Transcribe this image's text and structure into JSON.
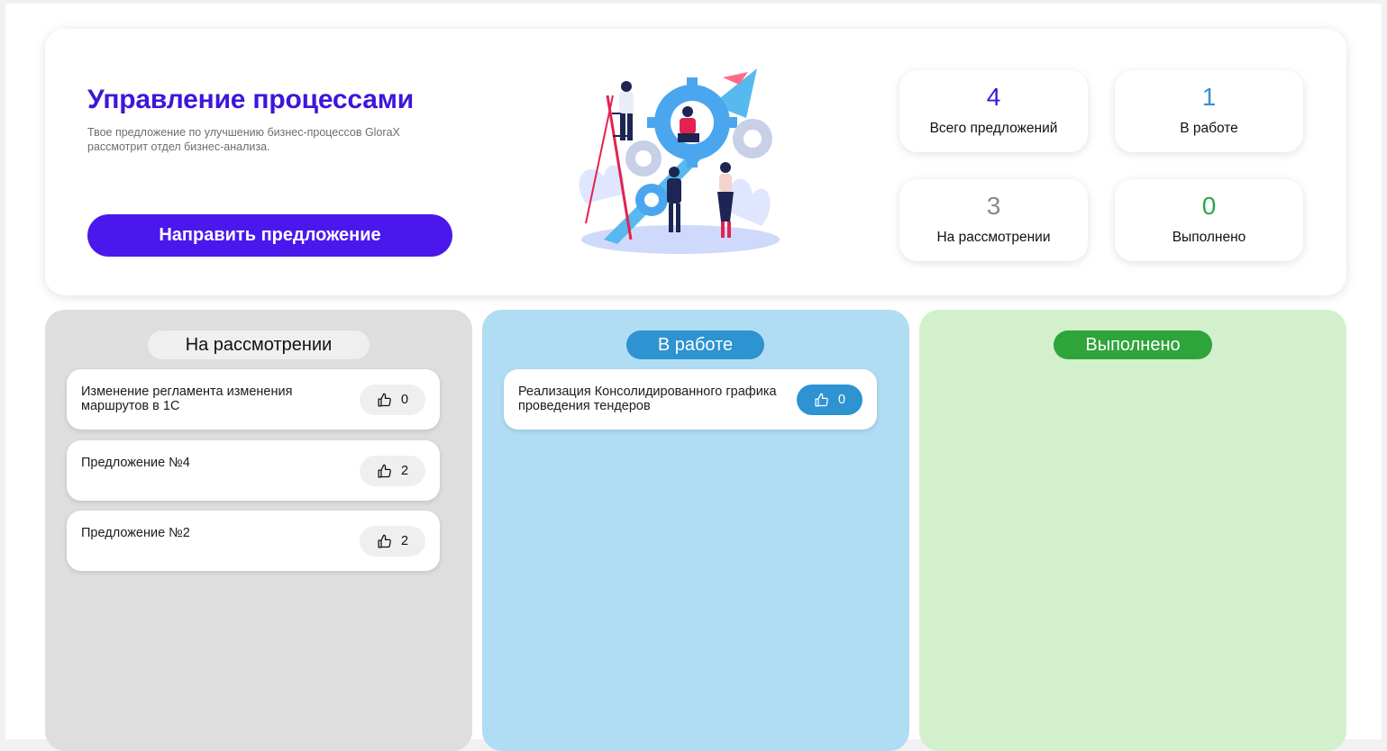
{
  "header": {
    "title": "Управление процессами",
    "subtitle": "Твое предложение по улучшению бизнес-процессов GloraX рассмотрит отдел бизнес-анализа.",
    "submit_button": "Направить предложение",
    "illustration_icon": "teamwork-gears-illustration"
  },
  "stats": [
    {
      "value": "4",
      "label": "Всего предложений",
      "color": "#3d16dc"
    },
    {
      "value": "1",
      "label": "В работе",
      "color": "#2e93d1"
    },
    {
      "value": "3",
      "label": "На рассмотрении",
      "color": "#8a8a8a"
    },
    {
      "value": "0",
      "label": "Выполнено",
      "color": "#2ea44f"
    }
  ],
  "columns": [
    {
      "title": "На рассмотрении",
      "bg": "#dedede",
      "badge_bg": "#efefef",
      "badge_color": "#111111",
      "cards": [
        {
          "text": "Изменение регламента изменения маршрутов в 1С",
          "likes": "0"
        },
        {
          "text": "Предложение №4",
          "likes": "2"
        },
        {
          "text": "Предложение №2",
          "likes": "2"
        }
      ]
    },
    {
      "title": "В работе",
      "bg": "#b1ddf4",
      "badge_bg": "#2e93d1",
      "badge_color": "#ffffff",
      "cards": [
        {
          "text": "Реализация Консолидированного графика проведения тендеров",
          "likes": "0"
        }
      ]
    },
    {
      "title": "Выполнено",
      "bg": "#d3f0cd",
      "badge_bg": "#2ea43a",
      "badge_color": "#ffffff",
      "cards": []
    }
  ],
  "like_icon": "thumbs-up-icon"
}
